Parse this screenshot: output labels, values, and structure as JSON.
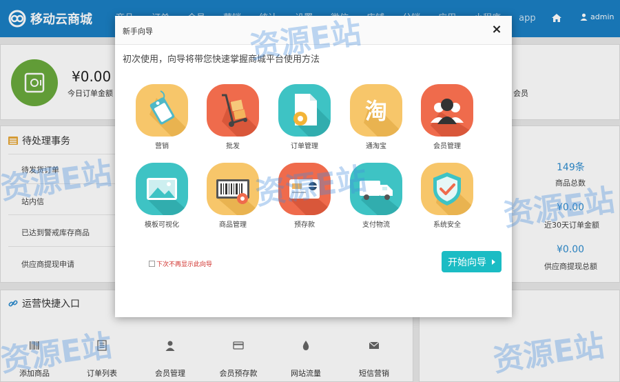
{
  "header": {
    "logo_text": "移动云商城",
    "nav": [
      "商品",
      "订单",
      "会员",
      "营销",
      "统计",
      "设置",
      "微信",
      "店铺",
      "分销",
      "应用",
      "小程序",
      "app"
    ],
    "user": "admin"
  },
  "stats": {
    "amount": "¥0.00",
    "amount_label": "今日订单金额",
    "right_label": "会员"
  },
  "pending": {
    "title": "待处理事务",
    "rows": [
      "待发货订单",
      "站内信",
      "已达到警戒库存商品",
      "供应商提现申请"
    ]
  },
  "right_stats": [
    {
      "value": "149条",
      "label": "商品总数"
    },
    {
      "value": "¥0.00",
      "label": "近30天订单金额"
    },
    {
      "value": "¥0.00",
      "label": "供应商提现总额"
    }
  ],
  "quick": {
    "title": "运营快捷入口",
    "items": [
      "添加商品",
      "订单列表",
      "会员管理",
      "会员预存款",
      "网站流量",
      "短信营销"
    ]
  },
  "modal": {
    "title": "新手向导",
    "close": "×",
    "intro": "初次使用，向导将带您快速掌握商城平台使用方法",
    "tiles": [
      {
        "label": "营销",
        "icon": "price-tag-icon",
        "color": "#f7c66a"
      },
      {
        "label": "批发",
        "icon": "hand-truck-icon",
        "color": "#ef6b4c"
      },
      {
        "label": "订单管理",
        "icon": "document-gear-icon",
        "color": "#3ec3c4"
      },
      {
        "label": "通淘宝",
        "icon": "taobao-icon",
        "color": "#f7c66a"
      },
      {
        "label": "会员管理",
        "icon": "members-icon",
        "color": "#ef6b4c"
      },
      {
        "label": "模板可视化",
        "icon": "picture-icon",
        "color": "#3ec3c4"
      },
      {
        "label": "商品管理",
        "icon": "barcode-icon",
        "color": "#f7c66a"
      },
      {
        "label": "预存款",
        "icon": "card-icon",
        "color": "#ef6b4c"
      },
      {
        "label": "支付物流",
        "icon": "truck-icon",
        "color": "#3ec3c4"
      },
      {
        "label": "系统安全",
        "icon": "shield-check-icon",
        "color": "#f7c66a"
      }
    ],
    "checkbox_label": "下次不再显示此向导",
    "start_button": "开始向导"
  },
  "watermark": "资源E站"
}
